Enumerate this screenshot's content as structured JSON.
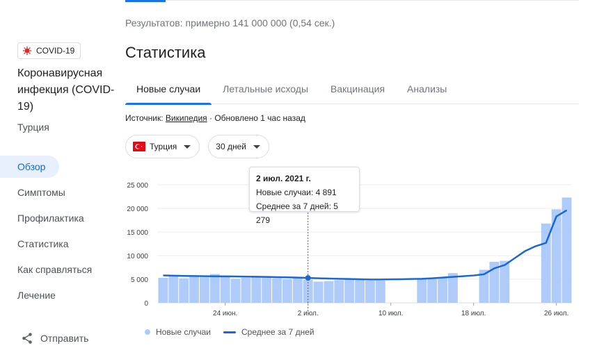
{
  "results_text": "Результатов: примерно 141 000 000 (0,54 сек.)",
  "left": {
    "chip_label": "COVID-19",
    "title": "Коронавирусная инфекция (COVID-19)",
    "country": "Турция",
    "nav": [
      "Обзор",
      "Симптомы",
      "Профилактика",
      "Статистика",
      "Как справляться",
      "Лечение"
    ],
    "share": "Отправить"
  },
  "main": {
    "title": "Статистика",
    "tabs": [
      "Новые случаи",
      "Летальные исходы",
      "Вакцинация",
      "Анализы"
    ],
    "source_prefix": "Источник: ",
    "source_link": "Википедия",
    "source_suffix": " · Обновлено 1 час назад",
    "filter_country": "Турция",
    "filter_period": "30 дней"
  },
  "tooltip": {
    "date": "2 июл. 2021 г.",
    "new_cases": "Новые случаи: 4 891",
    "avg": "Среднее за 7 дней: 5 279"
  },
  "legend": {
    "bars": "Новые случаи",
    "line": "Среднее за 7 дней"
  },
  "colors": {
    "bar": "#aecbfa",
    "line": "#1967d2",
    "accent": "#1a73e8"
  },
  "chart_data": {
    "type": "bar",
    "y_ticks": [
      "25 000",
      "20 000",
      "15 000",
      "10 000",
      "5 000",
      "0"
    ],
    "y_tick_values": [
      25000,
      20000,
      15000,
      10000,
      5000,
      0
    ],
    "ylim": [
      0,
      25000
    ],
    "x_tick_labels": [
      "24 июн.",
      "2 июл.",
      "10 июл.",
      "18 июл.",
      "26 июл."
    ],
    "x_tick_index": [
      6,
      14,
      22,
      30,
      38
    ],
    "grid": true,
    "legend_position": "bottom",
    "highlight_index": 14,
    "series": [
      {
        "name": "Новые случаи",
        "kind": "bar",
        "values": [
          5300,
          5700,
          5200,
          5500,
          5400,
          6100,
          5800,
          5100,
          5300,
          5600,
          5400,
          5200,
          5000,
          5300,
          4891,
          4500,
          4600,
          4800,
          5000,
          4900,
          4700,
          4700,
          null,
          null,
          null,
          5200,
          5300,
          5400,
          6300,
          null,
          null,
          7000,
          8700,
          8900,
          null,
          null,
          null,
          16800,
          19800,
          22300
        ],
        "color": "#aecbfa"
      },
      {
        "name": "Среднее за 7 дней",
        "kind": "line",
        "values": [
          5800,
          5750,
          5700,
          5680,
          5650,
          5620,
          5600,
          5580,
          5560,
          5540,
          5500,
          5450,
          5400,
          5350,
          5279,
          5200,
          5150,
          5100,
          5050,
          5000,
          4950,
          4950,
          4980,
          5000,
          5050,
          5100,
          5200,
          5350,
          5500,
          5650,
          5800,
          6050,
          7300,
          8000,
          9500,
          11000,
          12000,
          12700,
          18300,
          19600
        ],
        "color": "#1967d2"
      }
    ]
  }
}
